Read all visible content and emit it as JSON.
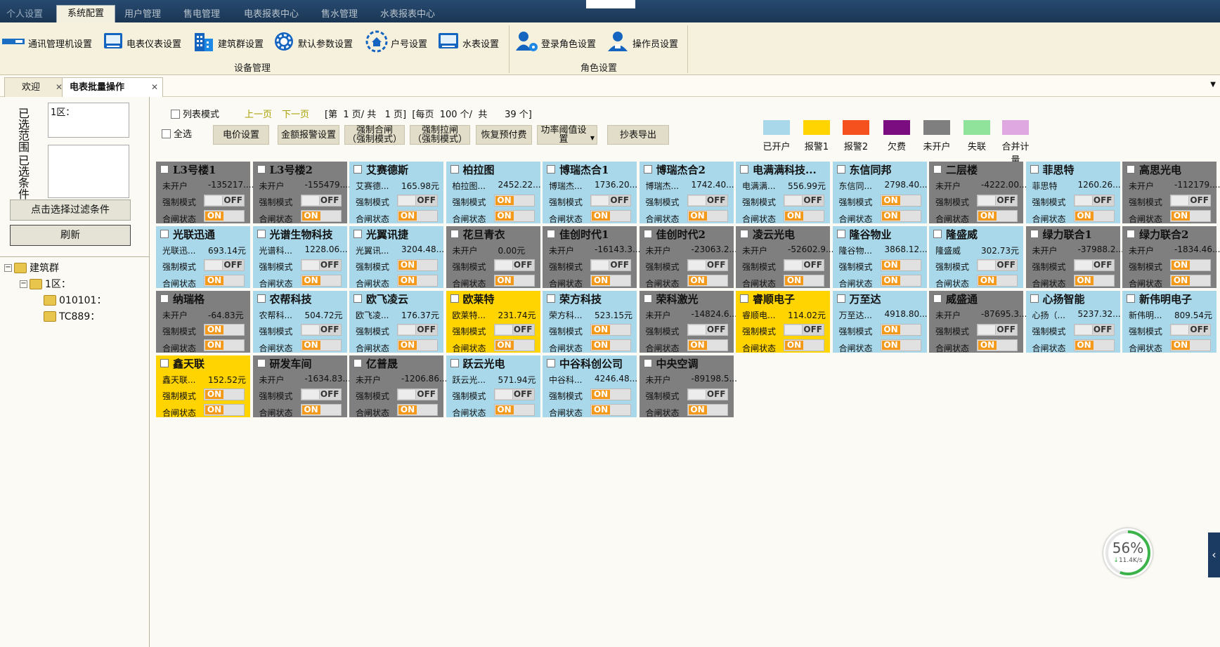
{
  "menu_tabs": [
    "个人设置",
    "系统配置",
    "用户管理",
    "售电管理",
    "电表报表中心",
    "售水管理",
    "水表报表中心"
  ],
  "ribbon": {
    "items": [
      {
        "label": "通讯管理机设置",
        "icon": "comm-manager-icon"
      },
      {
        "label": "电表仪表设置",
        "icon": "meter-icon"
      },
      {
        "label": "建筑群设置",
        "icon": "building-icon"
      },
      {
        "label": "默认参数设置",
        "icon": "gear-icon"
      },
      {
        "label": "户号设置",
        "icon": "household-icon"
      },
      {
        "label": "水表设置",
        "icon": "water-meter-icon"
      },
      {
        "label": "登录角色设置",
        "icon": "login-role-icon"
      },
      {
        "label": "操作员设置",
        "icon": "operator-icon"
      }
    ],
    "group_device": "设备管理",
    "group_role": "角色设置"
  },
  "doc_tabs": [
    "欢迎",
    "电表批量操作"
  ],
  "left": {
    "range_label": "已选范围",
    "range_value": "1区：",
    "cond_label": "已选条件",
    "cond_value": "",
    "filter_button": "点击选择过滤条件",
    "refresh_button": "刷新",
    "tree": [
      "建筑群",
      "1区：",
      "010101：",
      "TC889："
    ]
  },
  "toolbar": {
    "list_mode": "列表模式",
    "prev": "上一页",
    "next": "下一页",
    "page_info": "[第  1 页/ 共   1 页]  [每页  100 个/  共      39 个]",
    "select_all": "全选",
    "btn_price": "电价设置",
    "btn_amount_alarm": "金额报警设置",
    "btn_force_close_1": "强制合闸",
    "btn_force_close_2": "（强制模式）",
    "btn_force_open_1": "强制拉闸",
    "btn_force_open_2": "（强制模式）",
    "btn_restore": "恢复预付费",
    "btn_power_1": "功率阈值设",
    "btn_power_2": "置",
    "btn_export": "抄表导出"
  },
  "legend": [
    {
      "label": "已开户",
      "color": "#a8d8ea"
    },
    {
      "label": "报警1",
      "color": "#ffd400"
    },
    {
      "label": "报警2",
      "color": "#f4511e"
    },
    {
      "label": "欠费",
      "color": "#7b0d80"
    },
    {
      "label": "未开户",
      "color": "#7f7f7f"
    },
    {
      "label": "失联",
      "color": "#8fe39a"
    },
    {
      "label": "合并计量",
      "color": "#e0a8e0"
    }
  ],
  "labels": {
    "force_mode": "强制模式",
    "close_state": "合闸状态",
    "on": "ON",
    "off": "OFF"
  },
  "cards": [
    {
      "title": "L3号楼1",
      "status": "未开户",
      "amount": "-135217....",
      "force": "OFF",
      "close": "ON",
      "color": "#7f7f7f"
    },
    {
      "title": "L3号楼2",
      "status": "未开户",
      "amount": "-155479....",
      "force": "OFF",
      "close": "ON",
      "color": "#7f7f7f"
    },
    {
      "title": "艾赛德斯",
      "status": "艾赛德...",
      "amount": "165.98元",
      "force": "OFF",
      "close": "ON",
      "color": "#a8d8ea"
    },
    {
      "title": "柏拉图",
      "status": "柏拉图...",
      "amount": "2452.22...",
      "force": "ON",
      "close": "ON",
      "color": "#a8d8ea"
    },
    {
      "title": "博瑞杰合1",
      "status": "博瑞杰...",
      "amount": "1736.20...",
      "force": "OFF",
      "close": "ON",
      "color": "#a8d8ea"
    },
    {
      "title": "博瑞杰合2",
      "status": "博瑞杰...",
      "amount": "1742.40...",
      "force": "OFF",
      "close": "ON",
      "color": "#a8d8ea"
    },
    {
      "title": "电满满科技...",
      "status": "电满满...",
      "amount": "556.99元",
      "force": "OFF",
      "close": "ON",
      "color": "#a8d8ea"
    },
    {
      "title": "东信同邦",
      "status": "东信同...",
      "amount": "2798.40...",
      "force": "ON",
      "close": "ON",
      "color": "#a8d8ea"
    },
    {
      "title": "二层楼",
      "status": "未开户",
      "amount": "-4222.00...",
      "force": "OFF",
      "close": "ON",
      "color": "#7f7f7f"
    },
    {
      "title": "菲思特",
      "status": "菲思特",
      "amount": "1260.26...",
      "force": "OFF",
      "close": "ON",
      "color": "#a8d8ea"
    },
    {
      "title": "高思光电",
      "status": "未开户",
      "amount": "-112179....",
      "force": "OFF",
      "close": "ON",
      "color": "#7f7f7f"
    },
    {
      "title": "光联迅通",
      "status": "光联迅...",
      "amount": "693.14元",
      "force": "OFF",
      "close": "ON",
      "color": "#a8d8ea"
    },
    {
      "title": "光谱生物科技",
      "status": "光谱科...",
      "amount": "1228.06...",
      "force": "OFF",
      "close": "ON",
      "color": "#a8d8ea"
    },
    {
      "title": "光翼讯捷",
      "status": "光翼讯...",
      "amount": "3204.48...",
      "force": "ON",
      "close": "ON",
      "color": "#a8d8ea"
    },
    {
      "title": "花旦青衣",
      "status": "未开户",
      "amount": "0.00元",
      "force": "OFF",
      "close": "ON",
      "color": "#7f7f7f"
    },
    {
      "title": "佳创时代1",
      "status": "未开户",
      "amount": "-16143.3...",
      "force": "OFF",
      "close": "ON",
      "color": "#7f7f7f"
    },
    {
      "title": "佳创时代2",
      "status": "未开户",
      "amount": "-23063.2...",
      "force": "OFF",
      "close": "ON",
      "color": "#7f7f7f"
    },
    {
      "title": "凌云光电",
      "status": "未开户",
      "amount": "-52602.9...",
      "force": "OFF",
      "close": "ON",
      "color": "#7f7f7f"
    },
    {
      "title": "隆谷物业",
      "status": "隆谷物...",
      "amount": "3868.12...",
      "force": "ON",
      "close": "ON",
      "color": "#a8d8ea"
    },
    {
      "title": "隆盛威",
      "status": "隆盛威",
      "amount": "302.73元",
      "force": "OFF",
      "close": "ON",
      "color": "#a8d8ea"
    },
    {
      "title": "绿力联合1",
      "status": "未开户",
      "amount": "-37988.2...",
      "force": "OFF",
      "close": "ON",
      "color": "#7f7f7f"
    },
    {
      "title": "绿力联合2",
      "status": "未开户",
      "amount": "-1834.46...",
      "force": "ON",
      "close": "ON",
      "color": "#7f7f7f"
    },
    {
      "title": "纳瑞格",
      "status": "未开户",
      "amount": "-64.83元",
      "force": "ON",
      "close": "ON",
      "color": "#7f7f7f"
    },
    {
      "title": "农帮科技",
      "status": "农帮科...",
      "amount": "504.72元",
      "force": "OFF",
      "close": "ON",
      "color": "#a8d8ea"
    },
    {
      "title": "欧飞凌云",
      "status": "欧飞凌...",
      "amount": "176.37元",
      "force": "OFF",
      "close": "ON",
      "color": "#a8d8ea"
    },
    {
      "title": "欧莱特",
      "status": "欧莱特...",
      "amount": "231.74元",
      "force": "OFF",
      "close": "ON",
      "color": "#ffd400"
    },
    {
      "title": "荣方科技",
      "status": "荣方科...",
      "amount": "523.15元",
      "force": "ON",
      "close": "ON",
      "color": "#a8d8ea"
    },
    {
      "title": "荣科激光",
      "status": "未开户",
      "amount": "-14824.6...",
      "force": "OFF",
      "close": "ON",
      "color": "#7f7f7f"
    },
    {
      "title": "睿顺电子",
      "status": "睿顺电...",
      "amount": "114.02元",
      "force": "OFF",
      "close": "ON",
      "color": "#ffd400"
    },
    {
      "title": "万至达",
      "status": "万至达...",
      "amount": "4918.80...",
      "force": "ON",
      "close": "ON",
      "color": "#a8d8ea"
    },
    {
      "title": "威盛通",
      "status": "未开户",
      "amount": "-87695.3...",
      "force": "OFF",
      "close": "ON",
      "color": "#7f7f7f"
    },
    {
      "title": "心扬智能",
      "status": "心扬（...",
      "amount": "5237.32...",
      "force": "OFF",
      "close": "ON",
      "color": "#a8d8ea"
    },
    {
      "title": "新伟明电子",
      "status": "新伟明...",
      "amount": "809.54元",
      "force": "OFF",
      "close": "ON",
      "color": "#a8d8ea"
    },
    {
      "title": "鑫天联",
      "status": "鑫天联...",
      "amount": "152.52元",
      "force": "ON",
      "close": "ON",
      "color": "#ffd400"
    },
    {
      "title": "研发车间",
      "status": "未开户",
      "amount": "-1634.83...",
      "force": "OFF",
      "close": "ON",
      "color": "#7f7f7f"
    },
    {
      "title": "亿普晟",
      "status": "未开户",
      "amount": "-1206.86...",
      "force": "OFF",
      "close": "ON",
      "color": "#7f7f7f"
    },
    {
      "title": "跃云光电",
      "status": "跃云光...",
      "amount": "571.94元",
      "force": "OFF",
      "close": "ON",
      "color": "#a8d8ea"
    },
    {
      "title": "中谷科创公司",
      "status": "中谷科...",
      "amount": "4246.48...",
      "force": "ON",
      "close": "ON",
      "color": "#a8d8ea"
    },
    {
      "title": "中央空调",
      "status": "未开户",
      "amount": "-89198.5...",
      "force": "OFF",
      "close": "ON",
      "color": "#7f7f7f"
    }
  ],
  "speed": {
    "percent": "56%",
    "rate": "11.4K/s",
    "level": 0.56
  }
}
